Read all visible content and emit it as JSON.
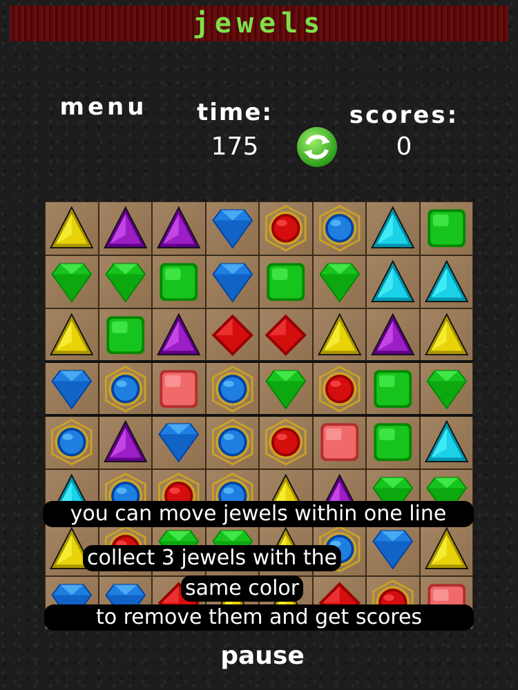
{
  "header": {
    "title": "jewels"
  },
  "hud": {
    "menu_label": "menu",
    "time_label": "time:",
    "time_value": "175",
    "scores_label": "scores:",
    "scores_value": "0",
    "refresh_icon": "refresh-icon"
  },
  "colors": {
    "yellow": "#e8d20a",
    "purple": "#9b1fc4",
    "blue": "#1f7fe0",
    "red": "#d40d0d",
    "cyan": "#1ad1e8",
    "green": "#17c41e",
    "pink": "#f06a6a",
    "navy": "#1a2a9c",
    "title_green": "#7ee04a"
  },
  "board": {
    "cols": 8,
    "rows": 8,
    "cells": [
      [
        "yellow-triangle",
        "purple-triangle",
        "purple-triangle",
        "blue-diamond",
        "red-orb",
        "blue-orb",
        "cyan-triangle",
        "green-square"
      ],
      [
        "green-diamond",
        "green-diamond",
        "green-square",
        "blue-diamond",
        "green-square",
        "green-diamond",
        "cyan-triangle",
        "cyan-triangle"
      ],
      [
        "yellow-triangle",
        "green-square",
        "purple-triangle",
        "red-rhombus",
        "red-rhombus",
        "yellow-triangle",
        "purple-triangle",
        "yellow-triangle"
      ],
      [
        "blue-diamond",
        "blue-orb",
        "pink-square",
        "blue-orb",
        "green-diamond",
        "red-orb",
        "green-square",
        "green-diamond"
      ],
      [
        "blue-orb",
        "purple-triangle",
        "blue-diamond",
        "blue-orb",
        "red-orb",
        "pink-square",
        "green-square",
        "cyan-triangle"
      ],
      [
        "cyan-triangle",
        "blue-orb",
        "red-orb",
        "blue-orb",
        "yellow-triangle",
        "purple-triangle",
        "green-diamond",
        "green-diamond"
      ],
      [
        "yellow-triangle",
        "red-orb",
        "green-diamond",
        "green-diamond",
        "yellow-triangle",
        "blue-orb",
        "blue-diamond",
        "yellow-triangle"
      ],
      [
        "blue-diamond",
        "blue-diamond",
        "red-rhombus",
        "yellow-triangle",
        "yellow-triangle",
        "red-rhombus",
        "red-orb",
        "pink-square"
      ]
    ]
  },
  "tips": {
    "line1": "you can move jewels within one line",
    "line2": "collect 3 jewels with the",
    "line3": "same color",
    "line4": "to remove them and get scores"
  },
  "footer": {
    "pause_label": "pause"
  }
}
